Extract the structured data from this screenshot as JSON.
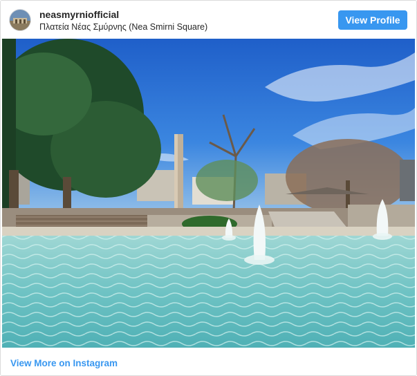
{
  "header": {
    "username": "neasmyrniofficial",
    "location": "Πλατεία Νέας Σμύρνης (Nea Smirni Square)",
    "view_profile_label": "View Profile"
  },
  "photo": {
    "subject": "fountain-square-photo"
  },
  "footer": {
    "view_more_label": "View More on Instagram"
  },
  "colors": {
    "accent": "#3897f0",
    "text": "#262626",
    "border": "#dbdbdb"
  }
}
